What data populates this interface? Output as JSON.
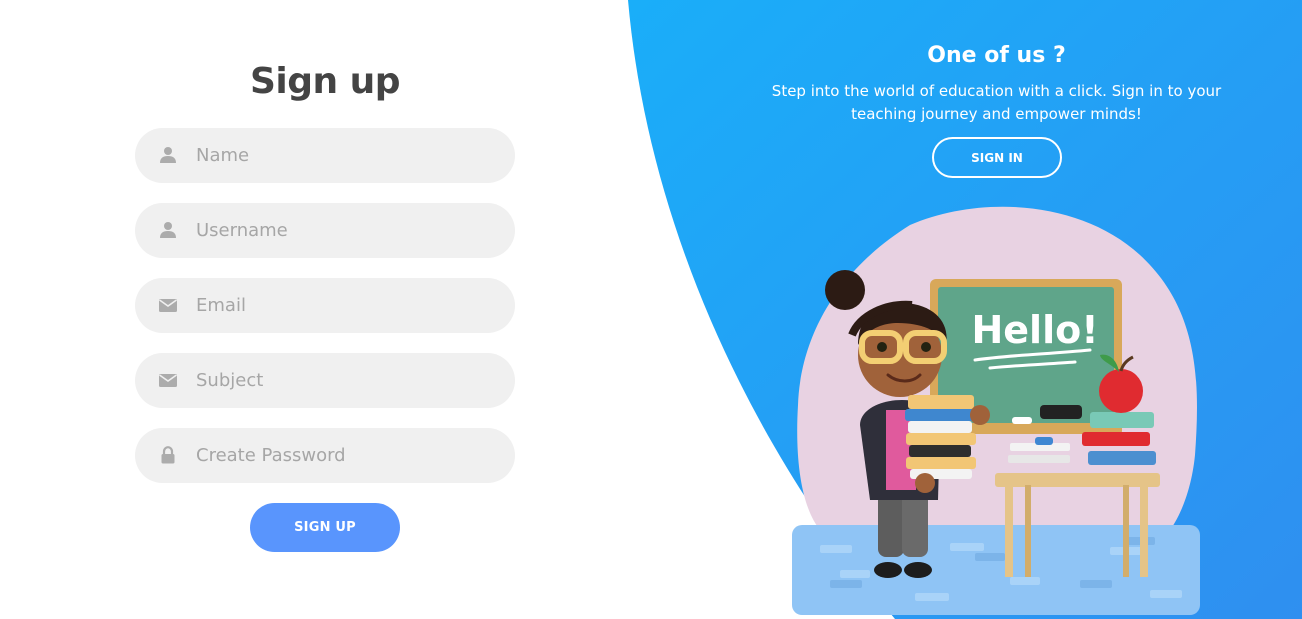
{
  "signup": {
    "title": "Sign up",
    "fields": [
      {
        "placeholder": "Name",
        "icon": "user-icon"
      },
      {
        "placeholder": "Username",
        "icon": "user-icon"
      },
      {
        "placeholder": "Email",
        "icon": "envelope-icon"
      },
      {
        "placeholder": "Subject",
        "icon": "envelope-icon"
      },
      {
        "placeholder": "Create Password",
        "icon": "lock-icon"
      }
    ],
    "button_label": "SIGN UP"
  },
  "panel": {
    "title": "One of us ?",
    "description": "Step into the world of education with a click. Sign in to your teaching journey and empower minds!",
    "button_label": "SIGN IN",
    "illustration_text": "Hello!"
  },
  "colors": {
    "accent": "#5995fd",
    "panel_blue": "#1ea7f7",
    "field_bg": "#f0f0f0",
    "title": "#444444",
    "placeholder": "#a6a6a6"
  }
}
